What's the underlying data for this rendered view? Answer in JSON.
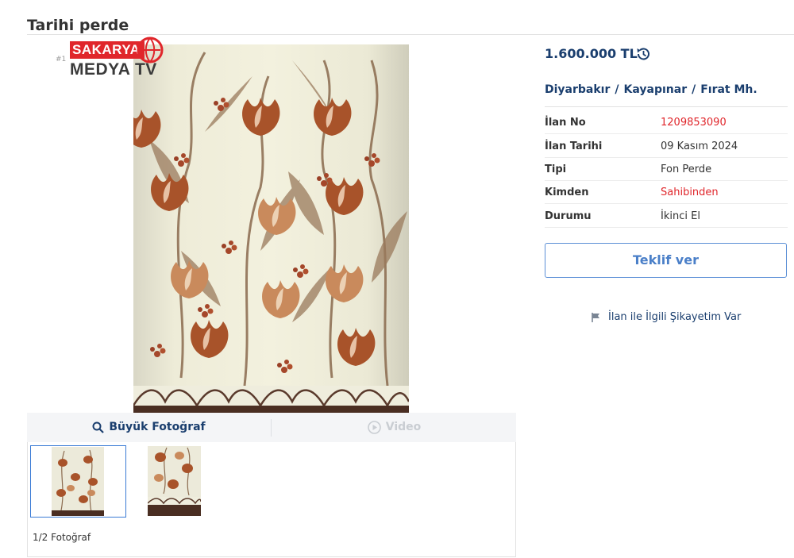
{
  "listing": {
    "title": "Tarihi perde"
  },
  "watermark": {
    "hash": "#1",
    "top": "SAKARYA",
    "bottom": "MEDYA TV"
  },
  "photo_viewer": {
    "big_photo_label": "Büyük Fotoğraf",
    "video_label": "Video",
    "photo_count": "1/2 Fotoğraf"
  },
  "price": "1.600.000 TL",
  "location": {
    "city": "Diyarbakır",
    "district": "Kayapınar",
    "neighborhood": "Fırat Mh.",
    "separator": "/"
  },
  "details": [
    {
      "label": "İlan No",
      "value": "1209853090",
      "highlight": true
    },
    {
      "label": "İlan Tarihi",
      "value": "09 Kasım 2024",
      "highlight": false
    },
    {
      "label": "Tipi",
      "value": "Fon Perde",
      "highlight": false
    },
    {
      "label": "Kimden",
      "value": "Sahibinden",
      "highlight": true
    },
    {
      "label": "Durumu",
      "value": "İkinci El",
      "highlight": false
    }
  ],
  "offer_button": "Teklif ver",
  "complaint_link": "İlan ile İlgili Şikayetim Var",
  "colors": {
    "brand_blue": "#1a3e6e",
    "accent_red": "#e0262b",
    "button_border": "#5b8fd6"
  },
  "icons": {
    "price_history": "history-icon",
    "search": "magnifier-icon",
    "video": "play-circle-icon",
    "complaint": "flag-icon"
  }
}
